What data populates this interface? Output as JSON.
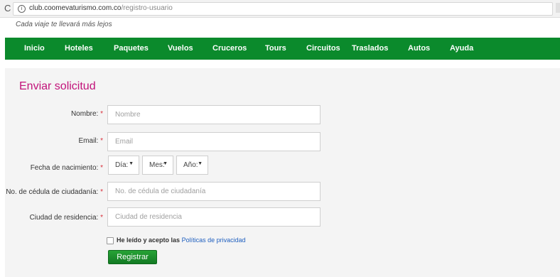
{
  "browser": {
    "url_domain": "club.coomevaturismo.com.co",
    "url_path": "/registro-usuario",
    "reload_glyph": "C",
    "info_glyph": "i",
    "star_glyph": "☆"
  },
  "header": {
    "tagline": "Cada viaje te llevará más lejos"
  },
  "nav": {
    "items": [
      "Inicio",
      "Hoteles",
      "Paquetes",
      "Vuelos",
      "Cruceros",
      "Tours",
      "Circuitos",
      "Traslados",
      "Autos",
      "Ayuda"
    ]
  },
  "form": {
    "title": "Enviar solicitud",
    "required_mark": "*",
    "fields": {
      "nombre": {
        "label": "Nombre:",
        "placeholder": "Nombre"
      },
      "email": {
        "label": "Email:",
        "placeholder": "Email"
      },
      "birth": {
        "label": "Fecha de nacimiento:",
        "day": "Día:",
        "month": "Mes:",
        "year": "Año:"
      },
      "cedula": {
        "label": "No. de cédula de ciudadanía:",
        "placeholder": "No. de cédula de ciudadanía"
      },
      "ciudad": {
        "label": "Ciudad de residencia:",
        "placeholder": "Ciudad de residencia"
      }
    },
    "terms_text": "He leído y acepto las",
    "terms_link": "Políticas de privacidad",
    "submit_label": "Registrar",
    "caret_glyph": "▼"
  },
  "colors": {
    "nav_bg": "#0b8a2c",
    "title": "#c2137a",
    "link": "#1f5fbf",
    "button": "#1a8e2c"
  }
}
